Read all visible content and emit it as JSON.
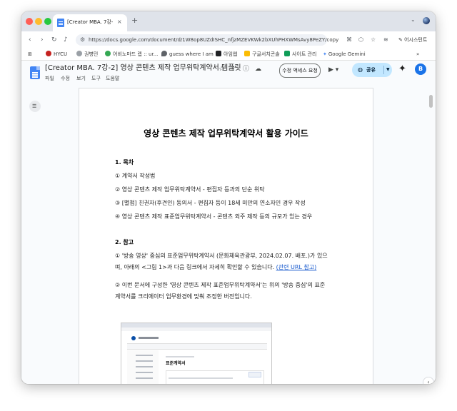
{
  "browser": {
    "tab": {
      "title": "[Creator MBA. 7강-2] 영상 콘텐츠",
      "close": "×"
    },
    "new_tab": "+",
    "tabs_dropdown": "⌄",
    "url": "https://docs.google.com/document/d/1W8op8UZdISHC_nfjzMZEVKWk2bXUhPHXWMsAvy8PeZY/copy",
    "assistant_label": "어시스턴트",
    "bookmarks": [
      {
        "label": "HYCU",
        "color": "#c5221f"
      },
      {
        "label": "권병민",
        "color": "#9aa0a6"
      },
      {
        "label": "어비노마드 랩 :: ur...",
        "color": "#34a853"
      },
      {
        "label": "guess where I am",
        "color": "#5f6368"
      },
      {
        "label": "아임웹",
        "color": "#202124"
      },
      {
        "label": "구글서치콘솔",
        "color": "#fbbc04"
      },
      {
        "label": "사이트 관리",
        "color": "#0f9d58"
      },
      {
        "label": "Google Gemini",
        "color": "#4285f4"
      }
    ],
    "bookmarks_more": "»"
  },
  "docs": {
    "title": "[Creator MBA. 7강-2] 영상 콘텐츠 제작 업무위탁계약서 템플릿",
    "menu": [
      "파일",
      "수정",
      "보기",
      "도구",
      "도움말"
    ],
    "request_edit": "수정 액세스 요청",
    "share": "공유",
    "avatar_letter": "B"
  },
  "document": {
    "heading": "영상 콘텐츠 제작 업무위탁계약서 활용 가이드",
    "section1": {
      "title": "1. 목차",
      "items": [
        "① 계약서 작성법",
        "② 영상 콘텐츠 제작 업무위탁계약서 - 편집자 등과의 단순 위탁",
        "③ [별첨] 친권자(후견인) 동의서 - 편집자 등이 18세 미만의 연소자인 경우 작성",
        "④ 영상 콘텐츠 제작 표준업무위탁계약서 - 콘텐츠 외주 제작 등의 규모가 있는 경우"
      ]
    },
    "section2": {
      "title": "2. 참고",
      "para1": "① '방송 영상' 중심의 표준업무위탁계약서 (문화체육관광부, 2024.02.07. 배포.)가 있으며, 아래의 <그림 1>과 다음 링크에서 자세히 확인할 수 있습니다.",
      "link": "(관련 URL 참고)",
      "para2": "② 이번 문서에 구성한 '영상 콘텐츠 제작 표준업무위탁계약서'는 위의 '방송 중심'의 표준계약서를 크리에이터 업무환경에 맞춰 조정한 버전입니다."
    },
    "embedded_image": {
      "heading": "표준계약서"
    }
  }
}
